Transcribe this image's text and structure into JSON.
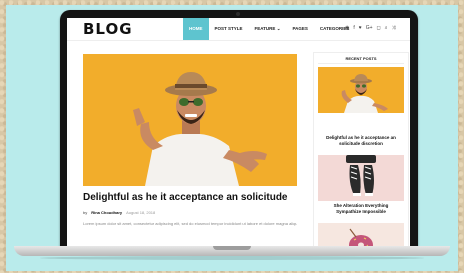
{
  "blog": {
    "logo": "BLOG",
    "nav": [
      "HOME",
      "POST STYLE",
      "FEATURE",
      "PAGES",
      "CATEGORIES"
    ],
    "social_icons": [
      "rss-icon",
      "facebook-icon",
      "twitter-icon",
      "google-plus-icon",
      "instagram-icon",
      "search-icon",
      "shuffle-icon"
    ],
    "post": {
      "title": "Delightful as he it acceptance an solicitude",
      "author_prefix": "by",
      "author": "Rina Choudhary",
      "date": "August 18, 2018",
      "excerpt": "Lorem ipsum dolor sit amet, consectetur adipiscing elit, sed do eiusmod tempor incididunt ut labore et dolore magna aliqua. Duis autem"
    },
    "sidebar": {
      "title": "RECENT POSTS",
      "items": [
        {
          "title_line1": "Delightful as he it acceptance an",
          "title_line2": "solicitude discretion"
        },
        {
          "title_line1": "She Alteration Everything",
          "title_line2": "Sympathize Impossible"
        }
      ]
    }
  },
  "colors": {
    "accent": "#5ec4cf",
    "hero_bg": "#f2ad2b",
    "teal_bg": "#b9ebeb"
  }
}
